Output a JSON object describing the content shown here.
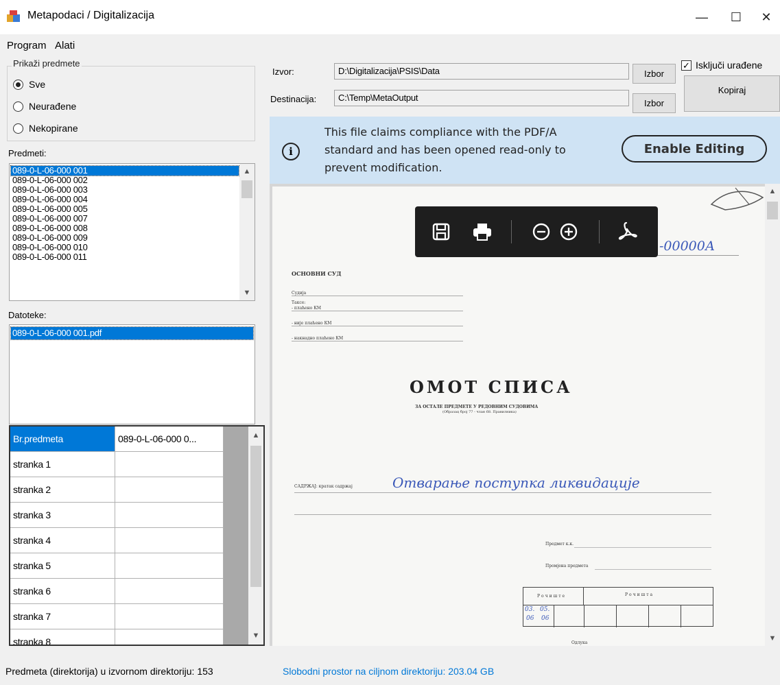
{
  "window": {
    "title": "Metapodaci / Digitalizacija",
    "minimize_glyph": "—",
    "maximize_glyph": "☐",
    "close_glyph": "✕"
  },
  "menu": {
    "items": [
      "Program",
      "Alati"
    ]
  },
  "filter": {
    "legend": "Prikaži predmete",
    "options": [
      {
        "label": "Sve",
        "selected": true
      },
      {
        "label": "Neurađene",
        "selected": false
      },
      {
        "label": "Nekopirane",
        "selected": false
      }
    ]
  },
  "predmeti": {
    "label": "Predmeti:",
    "items": [
      "089-0-L-06-000 001",
      "089-0-L-06-000 002",
      "089-0-L-06-000 003",
      "089-0-L-06-000 004",
      "089-0-L-06-000 005",
      "089-0-L-06-000 007",
      "089-0-L-06-000 008",
      "089-0-L-06-000 009",
      "089-0-L-06-000 010",
      "089-0-L-06-000 011"
    ],
    "selected_index": 0
  },
  "datoteke": {
    "label": "Datoteke:",
    "items": [
      "089-0-L-06-000 001.pdf"
    ],
    "selected_index": 0
  },
  "metadata_grid": {
    "rows": [
      {
        "key": "Br.predmeta",
        "value": "089-0-L-06-000 0..."
      },
      {
        "key": "stranka 1",
        "value": ""
      },
      {
        "key": "stranka 2",
        "value": ""
      },
      {
        "key": "stranka 3",
        "value": ""
      },
      {
        "key": "stranka 4",
        "value": ""
      },
      {
        "key": "stranka 5",
        "value": ""
      },
      {
        "key": "stranka 6",
        "value": ""
      },
      {
        "key": "stranka 7",
        "value": ""
      },
      {
        "key": "stranka 8",
        "value": ""
      }
    ]
  },
  "paths": {
    "izvor_label": "Izvor:",
    "izvor_value": "D:\\Digitalizacija\\PSIS\\Data",
    "destinacija_label": "Destinacija:",
    "destinacija_value": "C:\\Temp\\MetaOutput",
    "izbor_label": "Izbor"
  },
  "options": {
    "iskljuci_label": "Isključi urađene",
    "iskljuci_checked": true,
    "kopiraj_label": "Kopiraj"
  },
  "banner": {
    "message": "This file claims compliance with the PDF/A standard and has been opened read-only to prevent modification.",
    "button_label": "Enable Editing",
    "icon": "info-icon",
    "background": "#cfe3f4"
  },
  "pdf_toolbar": {
    "icons": [
      "save-icon",
      "print-icon",
      "zoom-out-icon",
      "zoom-in-icon",
      "adobe-acrobat-icon"
    ]
  },
  "document": {
    "title": "ОМОТ СПИСА",
    "subtitle": "ЗА ОСТАЛЕ ПРЕДМЕТЕ У РЕДОВНИМ СУДОВИМА",
    "subtitle2": "(Образац број 77 - члан 68. Правилника)",
    "court_label": "ОСНОВНИ СУД",
    "side_lines": [
      "Судија",
      "Таксе:",
      "- плаћено КМ",
      "- није плаћено КМ",
      "- накнадно плаћено КМ"
    ],
    "content_label": "САДРЖАЈ: кратак садржај",
    "handwritten_content": "Отварање поступка ликвидације",
    "handwritten_number": "-00000А",
    "lower_lines": [
      "Предмет к.к.",
      "Промјена предмета"
    ],
    "table_headers": [
      "Рочиште",
      "Рочишта"
    ],
    "handwritten_dates": [
      "03.",
      "05.",
      "06",
      "06"
    ],
    "footer_label": "Одлука"
  },
  "status": {
    "left": "Predmeta (direktorija) u izvornom direktoriju: 153",
    "right": "Slobodni prostor na ciljnom direktoriju: 203.04 GB"
  },
  "colors": {
    "selection": "#0078d7",
    "status_link": "#0078d7",
    "handwriting": "#3a58b8"
  }
}
